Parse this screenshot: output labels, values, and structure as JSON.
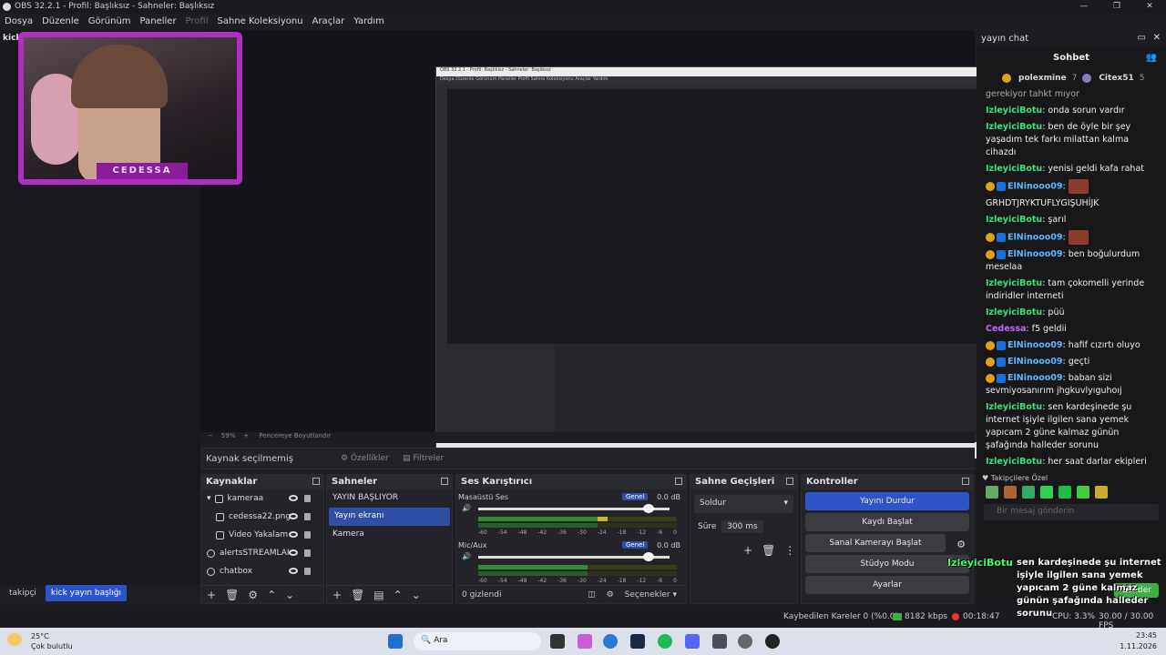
{
  "window": {
    "title": "OBS 32.2.1 - Profil: Başlıksız - Sahneler: Başlıksız",
    "minimize": "—",
    "maximize": "❐",
    "close": "✕"
  },
  "menu": [
    "Dosya",
    "Düzenle",
    "Görünüm",
    "Paneller",
    "Profil",
    "Sahne Koleksiyonu",
    "Araçlar",
    "Yardım"
  ],
  "kick_label": "kick",
  "facecam": {
    "name": "CEDESSA"
  },
  "zoom": {
    "minus": "−",
    "value": "59%",
    "plus": "+",
    "fit": "Pencereye Boyutlandır"
  },
  "source_info": {
    "text": "Kaynak seçilmemiş",
    "properties": "Özellikler",
    "filters": "Filtreler"
  },
  "sources": {
    "title": "Kaynaklar",
    "items": [
      {
        "name": "kameraa",
        "group": true
      },
      {
        "name": "cedessa22.png"
      },
      {
        "name": "Video Yakalam"
      },
      {
        "name": "alertsSTREAMLAI"
      },
      {
        "name": "chatbox"
      }
    ]
  },
  "scenes": {
    "title": "Sahneler",
    "items": [
      "YAYIN BAŞLIYOR",
      "Yayın ekranı",
      "Kamera"
    ],
    "active": "Yayın ekranı"
  },
  "mixer": {
    "title": "Ses Karıştırıcı",
    "tracks": [
      {
        "name": "Masaüstü Ses",
        "tag": "Genel",
        "db": "0.0 dB"
      },
      {
        "name": "Mic/Aux",
        "tag": "Genel",
        "db": "0.0 dB"
      }
    ],
    "ticks": [
      "-60",
      "-54",
      "-48",
      "-42",
      "-36",
      "-30",
      "-24",
      "-18",
      "-12",
      "-6",
      "0"
    ],
    "hidden": "0 gizlendi",
    "options": "Seçenekler"
  },
  "transitions": {
    "title": "Sahne Geçişleri",
    "type": "Soldur",
    "duration_label": "Süre",
    "duration": "300 ms"
  },
  "controls": {
    "title": "Kontroller",
    "buttons": [
      "Yayını Durdur",
      "Kaydı Başlat",
      "Sanal Kamerayı Başlat",
      "Stüdyo Modu",
      "Ayarlar"
    ]
  },
  "scene_tabs": [
    "takipçi",
    "kick yayın başlığı"
  ],
  "status": {
    "dropped": "Kaybedilen Kareler 0 (%0.0)",
    "bitrate": "8182 kbps",
    "time": "00:18:47",
    "cpu": "CPU: 3.3%",
    "fps": "30.00 / 30.00 FPS"
  },
  "chat": {
    "panel_title": "yayın chat",
    "tab": "Sohbet",
    "leaders": [
      {
        "name": "polexmine",
        "count": "7"
      },
      {
        "name": "Citex51",
        "count": "5"
      }
    ],
    "top_line": "gerekiyor tahkt mıyor",
    "messages": [
      {
        "user": "IzleyiciBotu",
        "text": ": onda sorun vardır",
        "c": "u"
      },
      {
        "user": "IzleyiciBotu",
        "text": ": ben de öyle bir şey yaşadım tek farkı milattan kalma cihazdı",
        "c": "u"
      },
      {
        "user": "IzleyiciBotu",
        "text": ": yenisi geldi kafa rahat",
        "c": "u"
      },
      {
        "user": "ElNinooo09",
        "text": ":",
        "c": "u2",
        "emote": true
      },
      {
        "user": "",
        "text": "GRHDTJRYKTUFLYGIŞUHİJK",
        "c": "u"
      },
      {
        "user": "IzleyiciBotu",
        "text": ": şarıl",
        "c": "u"
      },
      {
        "user": "ElNinooo09",
        "text": ":",
        "c": "u2",
        "emote": true
      },
      {
        "user": "ElNinooo09",
        "text": ": ben boğulurdum meselaa",
        "c": "u2"
      },
      {
        "user": "IzleyiciBotu",
        "text": ": tam çokomelli yerinde indiridler interneti",
        "c": "u"
      },
      {
        "user": "IzleyiciBotu",
        "text": ": püü",
        "c": "u"
      },
      {
        "user": "Cedessa",
        "text": ": f5 geldii",
        "c": "u3"
      },
      {
        "user": "ElNinooo09",
        "text": ": hafif cızırtı oluyo",
        "c": "u2"
      },
      {
        "user": "ElNinooo09",
        "text": ": geçti",
        "c": "u2"
      },
      {
        "user": "ElNinooo09",
        "text": ": baban sizi sevmiyosanırım jhgkuvlyıguhoıj",
        "c": "u2"
      },
      {
        "user": "IzleyiciBotu",
        "text": ": sen kardeşinede şu internet işiyle ilgilen sana yemek yapıcam 2 güne kalmaz günün şafağında halleder sorunu",
        "c": "u"
      },
      {
        "user": "IzleyiciBotu",
        "text": ": her saat darlar ekipleri",
        "c": "u"
      }
    ],
    "followers_label": "Takipçilere Özel",
    "input_placeholder": "Bir mesaj gönderin",
    "send": "Gönder"
  },
  "overlay_popup": {
    "user": "IzleyiciBotu",
    "text": "sen kardeşinede şu internet işiyle ilgilen sana yemek yapıcam 2 güne kalmaz günün şafağında halleder sorunu"
  },
  "taskbar": {
    "weather_temp": "25°C",
    "weather_desc": "Çok bulutlu",
    "search": "Ara",
    "time": "23:45",
    "date": "1.11.2026"
  }
}
